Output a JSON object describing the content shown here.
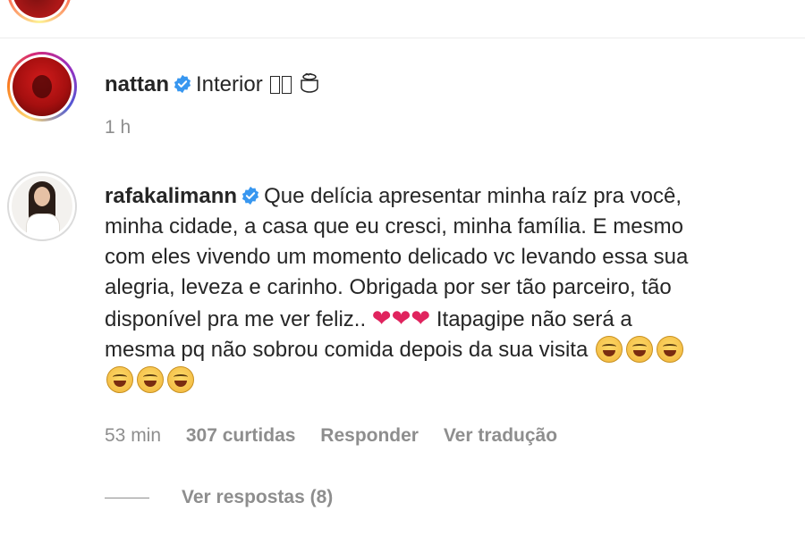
{
  "comments": [
    {
      "username": "nattan",
      "text": "Interior",
      "time": "1 h"
    },
    {
      "username": "rafakalimann",
      "lines": [
        "Que delícia apresentar minha raíz pra você,",
        "minha cidade, a casa que eu cresci, minha família. E mesmo",
        "com eles vivendo um momento delicado vc levando essa sua",
        "alegria, leveza e carinho. Obrigada por ser tão parceiro, tão",
        "disponível pra me ver feliz..",
        "Itapagipe não será a",
        "mesma pq não sobrou comida depois da sua visita"
      ],
      "time": "53 min",
      "likes": "307 curtidas",
      "reply": "Responder",
      "translate": "Ver tradução",
      "view_replies": "Ver respostas (8)"
    }
  ],
  "colors": {
    "verified_blue": "#3897f0",
    "meta_gray": "#8e8e8e",
    "heart_red": "#e0245e"
  },
  "icons": [
    "verified-badge-icon",
    "heart-emoji",
    "laughing-emoji",
    "cooking-pot-emoji"
  ]
}
